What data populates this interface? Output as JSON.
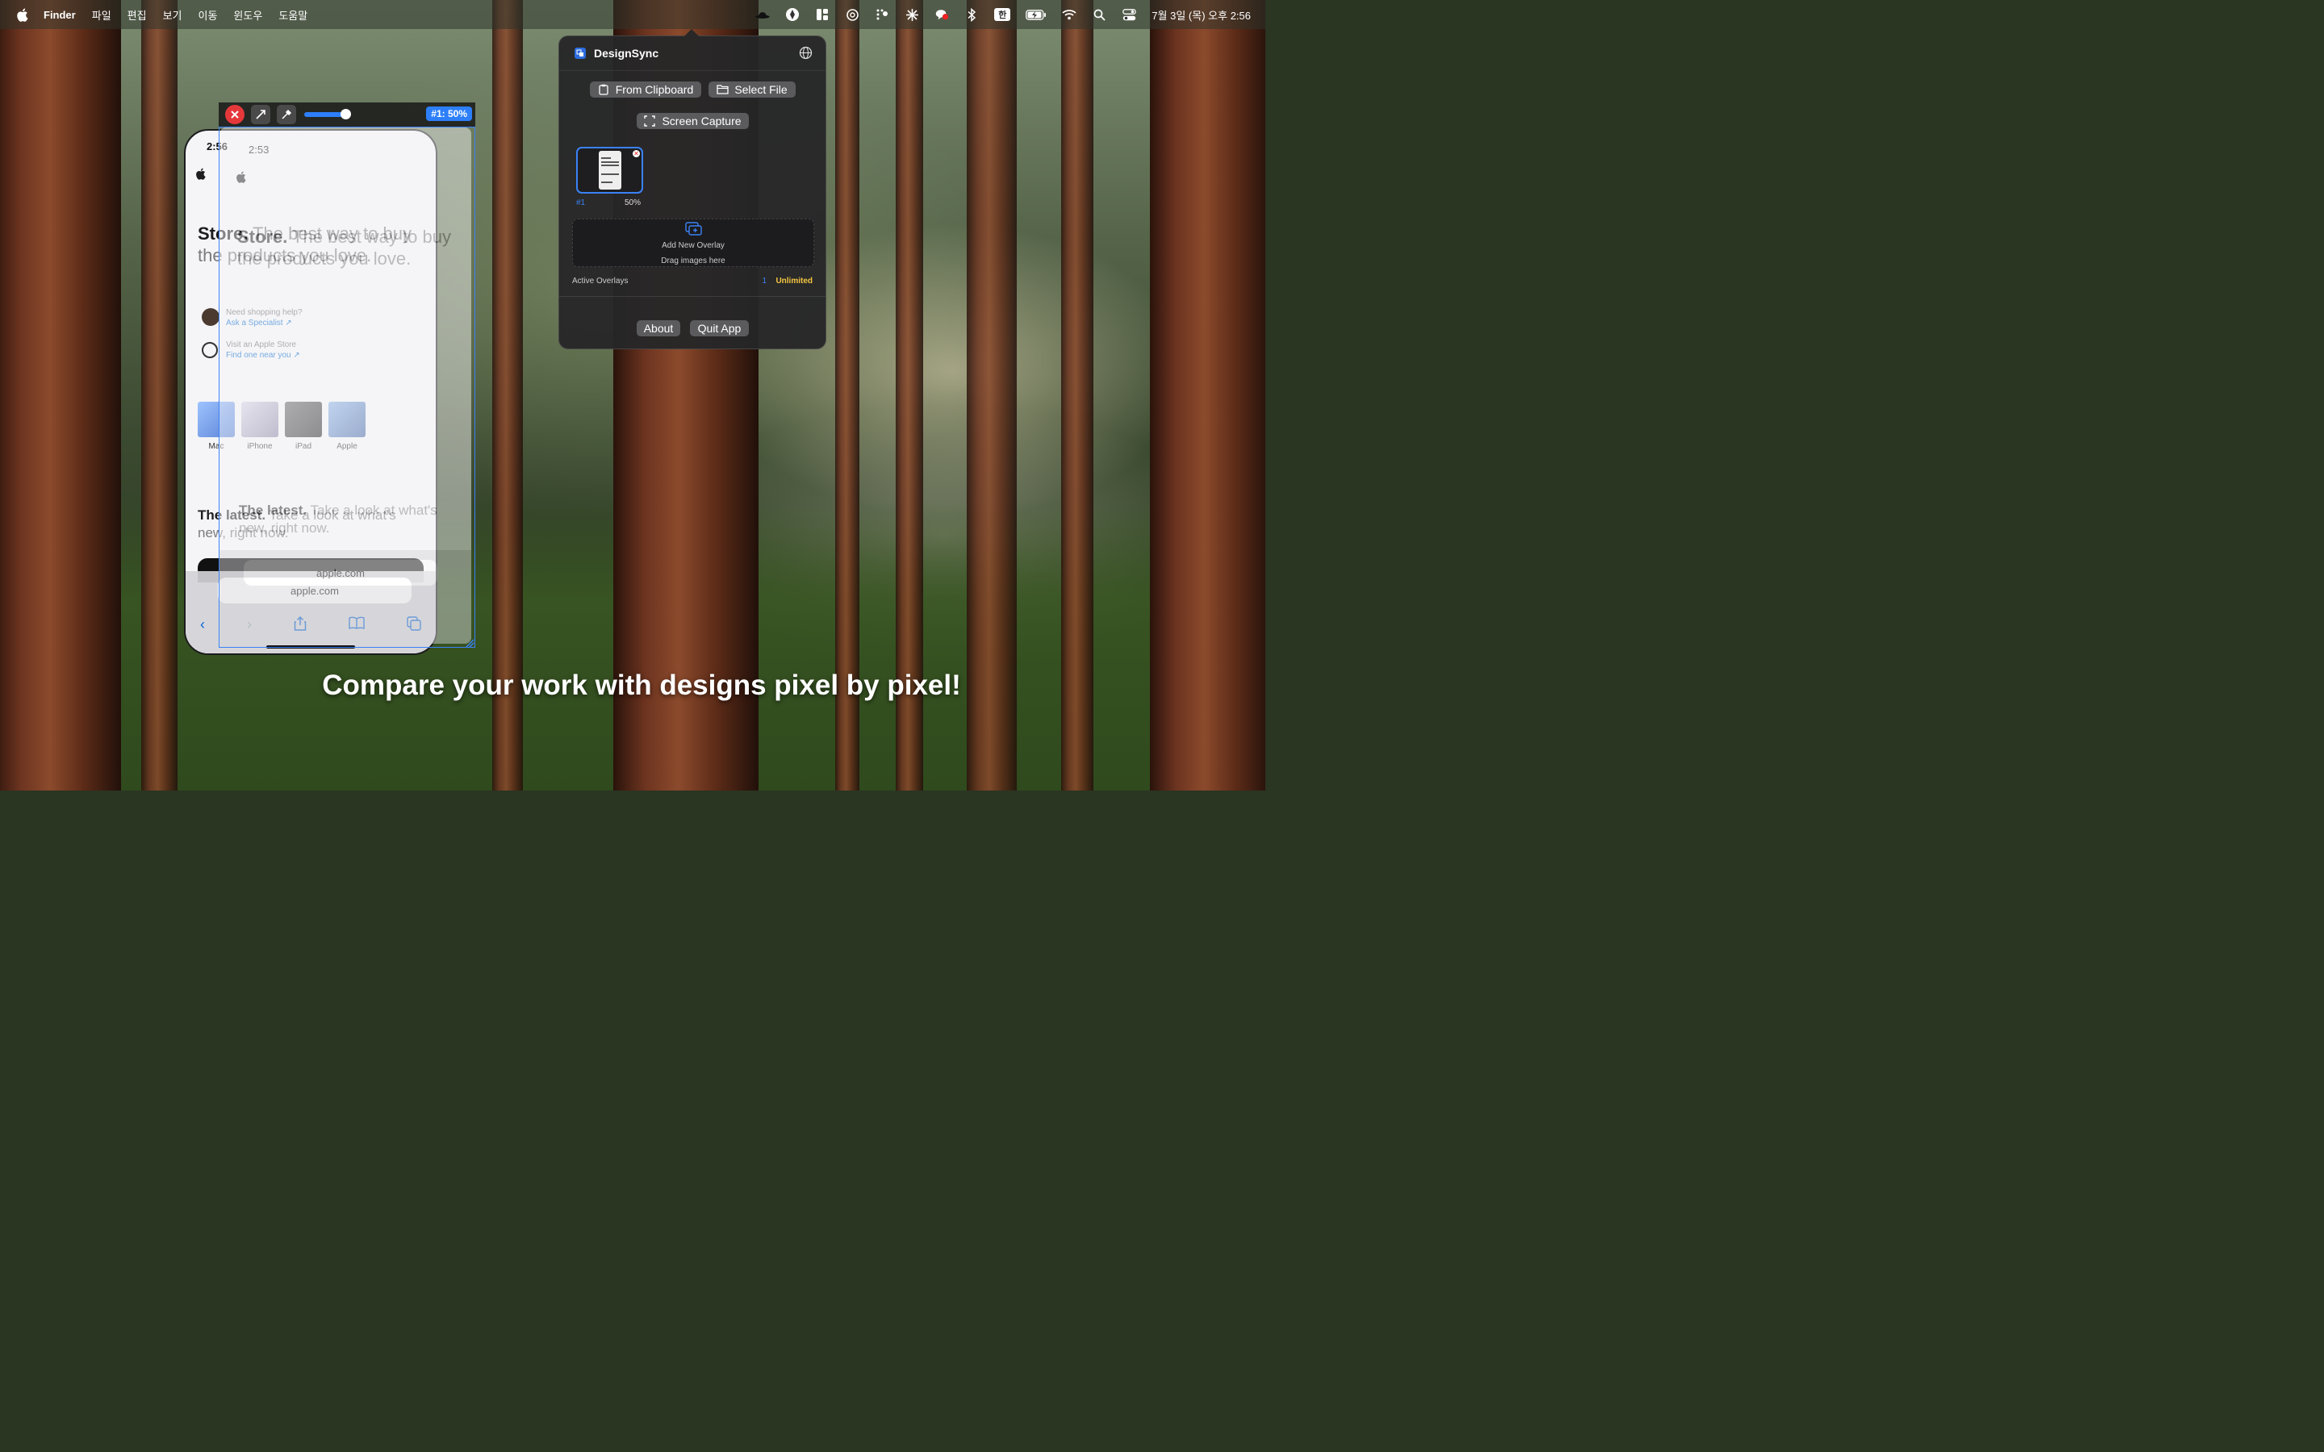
{
  "menubar": {
    "app_name": "Finder",
    "items": [
      "파일",
      "편집",
      "보기",
      "이동",
      "윈도우",
      "도움말"
    ],
    "input_source": "한",
    "clock": "7월 3일 (목) 오후 2:56"
  },
  "overlay_toolbar": {
    "opacity_badge": "#1: 50%"
  },
  "phone_base": {
    "time": "2:56",
    "hero_bold": "Store.",
    "hero_rest": " The best way to buy the products you love.",
    "help_title": "Need shopping help?",
    "help_link": "Ask a Specialist ↗",
    "visit_title": "Visit an Apple Store",
    "visit_link": "Find one near you ↗",
    "products": [
      "Mac",
      "iPhone",
      "iPad",
      "Apple"
    ],
    "latest_bold": "The latest.",
    "latest_rest": " Take a look at what's new, right now.",
    "url": "apple.com"
  },
  "phone_overlay": {
    "time": "2:53",
    "url": "apple.com"
  },
  "popover": {
    "title": "DesignSync",
    "from_clipboard": "From Clipboard",
    "select_file": "Select File",
    "screen_capture": "Screen Capture",
    "thumb_number": "#1",
    "thumb_percent": "50%",
    "add_overlay": "Add New Overlay",
    "drag_hint": "Drag images here",
    "active_label": "Active Overlays",
    "active_count": "1",
    "plan": "Unlimited",
    "about": "About",
    "quit": "Quit App"
  },
  "caption": "Compare your work with designs pixel by pixel!",
  "colors": {
    "accent": "#3b82f6",
    "close_red": "#e5383b",
    "unlimited_gold": "#f5c542"
  }
}
